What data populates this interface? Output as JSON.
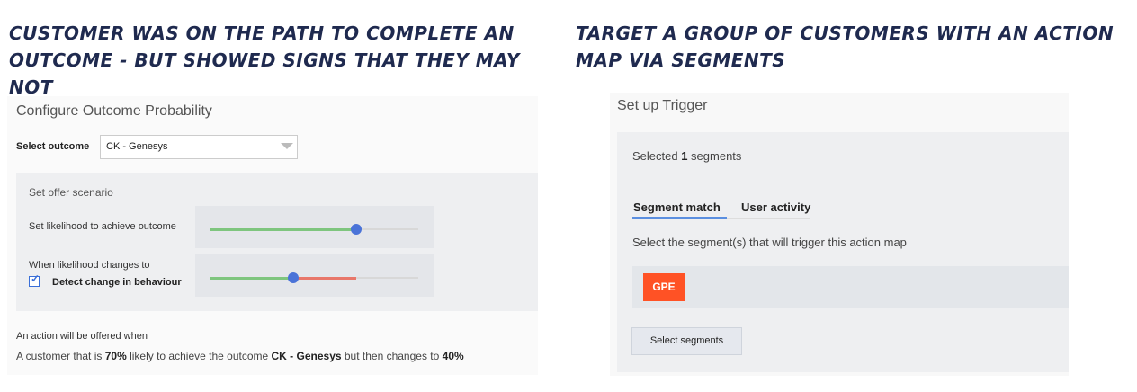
{
  "left": {
    "heading": "Customer was on the path to complete an outcome - but showed signs that they may not",
    "panel_title": "Configure Outcome Probability",
    "select_outcome_label": "Select outcome",
    "select_outcome_value": "CK - Genesys",
    "scenario_title": "Set offer scenario",
    "likelihood_label": "Set likelihood to achieve outcome",
    "likelihood_value_pct": 70,
    "changes_label": "When likelihood changes to",
    "changes_value_pct": 40,
    "detect_checkbox_label": "Detect change in behaviour",
    "detect_checked": true,
    "offer_label": "An action will be offered when",
    "offer_prefix": "A customer that is ",
    "offer_pct1": "70%",
    "offer_mid": " likely to achieve the outcome ",
    "offer_outcome": "CK - Genesys",
    "offer_mid2": " but then changes to ",
    "offer_pct2": "40%"
  },
  "right": {
    "heading": "Target a group of customers with an action map via segments",
    "panel_title": "Set up Trigger",
    "selected_prefix": "Selected ",
    "selected_count": "1",
    "selected_suffix": " segments",
    "tabs": [
      {
        "label": "Segment match",
        "active": true
      },
      {
        "label": "User activity",
        "active": false
      }
    ],
    "help_text": "Select the segment(s) that will trigger this action map",
    "segment_chip": "GPE",
    "select_button": "Select segments"
  },
  "colors": {
    "heading": "#1f2a4f",
    "slider_green": "#7ec57e",
    "slider_red": "#e8776a",
    "slider_thumb": "#4a73d8",
    "chip": "#ff5225",
    "tab_underline": "#5b8fe0"
  }
}
